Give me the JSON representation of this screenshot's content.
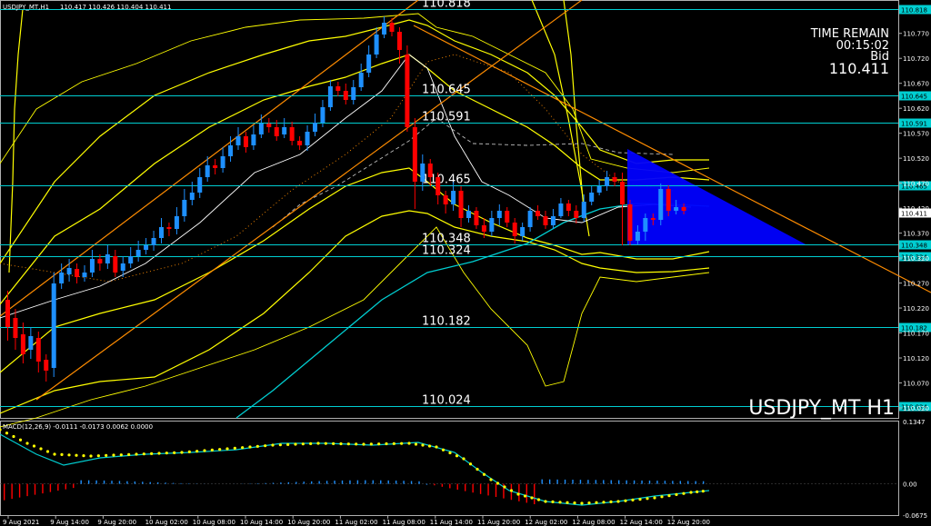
{
  "window": {
    "title": "USDJPY_MT,H1",
    "ohlc_header": "110.417 110.426 110.404 110.411",
    "symbol_watermark": "USDJPY_MT H1"
  },
  "info_panel": {
    "time_remain_label": "TIME REMAIN",
    "time_remain_value": "00:15:02",
    "bid_label": "Bid",
    "bid_value": "110.411"
  },
  "macd_header": "MACD(12,26,9) -0.0111 -0.0173 0.0062 0.0000",
  "colors": {
    "background": "#000000",
    "bull_candle": "#1e90ff",
    "bear_candle": "#ff0000",
    "level_line": "#00ced1",
    "bollinger": "#ffff00",
    "trendline": "#ff8c00",
    "triangle_fill": "#0000ff",
    "ma_line": "#00ced1",
    "signal_dots": "#ffff00"
  },
  "chart_data": [
    {
      "type": "candlestick",
      "title": "USDJPY_MT,H1",
      "ylim": [
        110.0,
        110.835
      ],
      "price_ticks": [
        "110.770",
        "110.720",
        "110.670",
        "110.620",
        "110.570",
        "110.520",
        "110.470",
        "110.420",
        "110.370",
        "110.320",
        "110.270",
        "110.220",
        "110.170",
        "110.120",
        "110.070",
        "110.020"
      ],
      "x_ticks": [
        "9 Aug 2021",
        "9 Aug 14:00",
        "9 Aug 20:00",
        "10 Aug 02:00",
        "10 Aug 08:00",
        "10 Aug 14:00",
        "10 Aug 20:00",
        "11 Aug 02:00",
        "11 Aug 08:00",
        "11 Aug 14:00",
        "11 Aug 20:00",
        "12 Aug 02:00",
        "12 Aug 08:00",
        "12 Aug 14:00",
        "12 Aug 20:00"
      ],
      "levels": [
        {
          "price": "110.818",
          "label": "110.818"
        },
        {
          "price": "110.645",
          "label": "110.645"
        },
        {
          "price": "110.591",
          "label": "110.591"
        },
        {
          "price": "110.465",
          "label": "110.465"
        },
        {
          "price": "110.348",
          "label": "110.348"
        },
        {
          "price": "110.324",
          "label": "110.324"
        },
        {
          "price": "110.182",
          "label": "110.182"
        },
        {
          "price": "110.024",
          "label": "110.024"
        }
      ],
      "current_price": "110.411"
    },
    {
      "type": "histogram",
      "title": "MACD(12,26,9)",
      "ylim": [
        -0.0675,
        0.1347
      ],
      "ticks": [
        "0.1347",
        "0.00",
        "-0.0675"
      ]
    }
  ]
}
